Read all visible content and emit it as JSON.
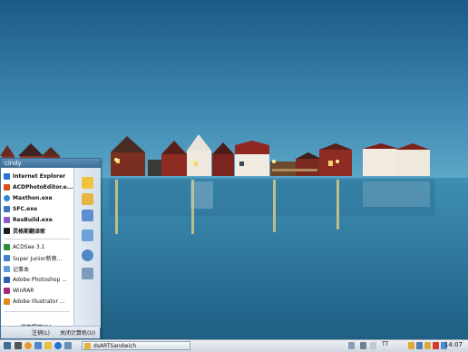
{
  "user": {
    "name": "cindy"
  },
  "start_menu": {
    "pinned": [
      {
        "label": "Internet Explorer",
        "icon": "internet-explorer-icon",
        "color": "#2a6fd6"
      },
      {
        "label": "ACDPhotoEditor.e...",
        "icon": "acdphotoeditor-icon",
        "color": "#d9501e"
      },
      {
        "label": "Maxthon.exe",
        "icon": "maxthon-icon",
        "color": "#2b8ad8"
      },
      {
        "label": "SFC.exe",
        "icon": "sfc-icon",
        "color": "#3d76c9"
      },
      {
        "label": "ResBuild.exe",
        "icon": "resbuild-icon",
        "color": "#8a5bc6"
      },
      {
        "label": "灵格斯翻译家",
        "icon": "lingoes-icon",
        "color": "#1d1d1d"
      }
    ],
    "recent": [
      {
        "label": "ACDSee 3.1",
        "icon": "acdsee-icon",
        "color": "#2f8e3a"
      },
      {
        "label": "Super Junior新奥...",
        "icon": "super-junior-icon",
        "color": "#3f7fd2"
      },
      {
        "label": "记事本",
        "icon": "notepad-icon",
        "color": "#5f9fd7"
      },
      {
        "label": "Adobe Photoshop ...",
        "icon": "photoshop-icon",
        "color": "#2c5fb0"
      },
      {
        "label": "WinRAR",
        "icon": "winrar-icon",
        "color": "#a52a7c"
      },
      {
        "label": "Adobe Illustrator ...",
        "icon": "illustrator-icon",
        "color": "#e28a1a"
      }
    ],
    "all_programs": "所有程序(P)",
    "logoff": "注销(L)",
    "shutdown": "关闭计算机(U)",
    "quick_icons": [
      {
        "icon": "documents-folder-icon",
        "color": "#f0c23d"
      },
      {
        "icon": "pictures-folder-icon",
        "color": "#e7b445"
      },
      {
        "icon": "my-computer-icon",
        "color": "#5d8fd0"
      },
      {
        "icon": "control-panel-icon",
        "color": "#6da2d9"
      },
      {
        "icon": "search-icon",
        "color": "#4f86c6"
      },
      {
        "icon": "run-icon",
        "color": "#7c9bbd"
      }
    ]
  },
  "taskbar": {
    "active_window": "dsARTSandwich",
    "tray_text": "TT",
    "clock": "14:07"
  }
}
